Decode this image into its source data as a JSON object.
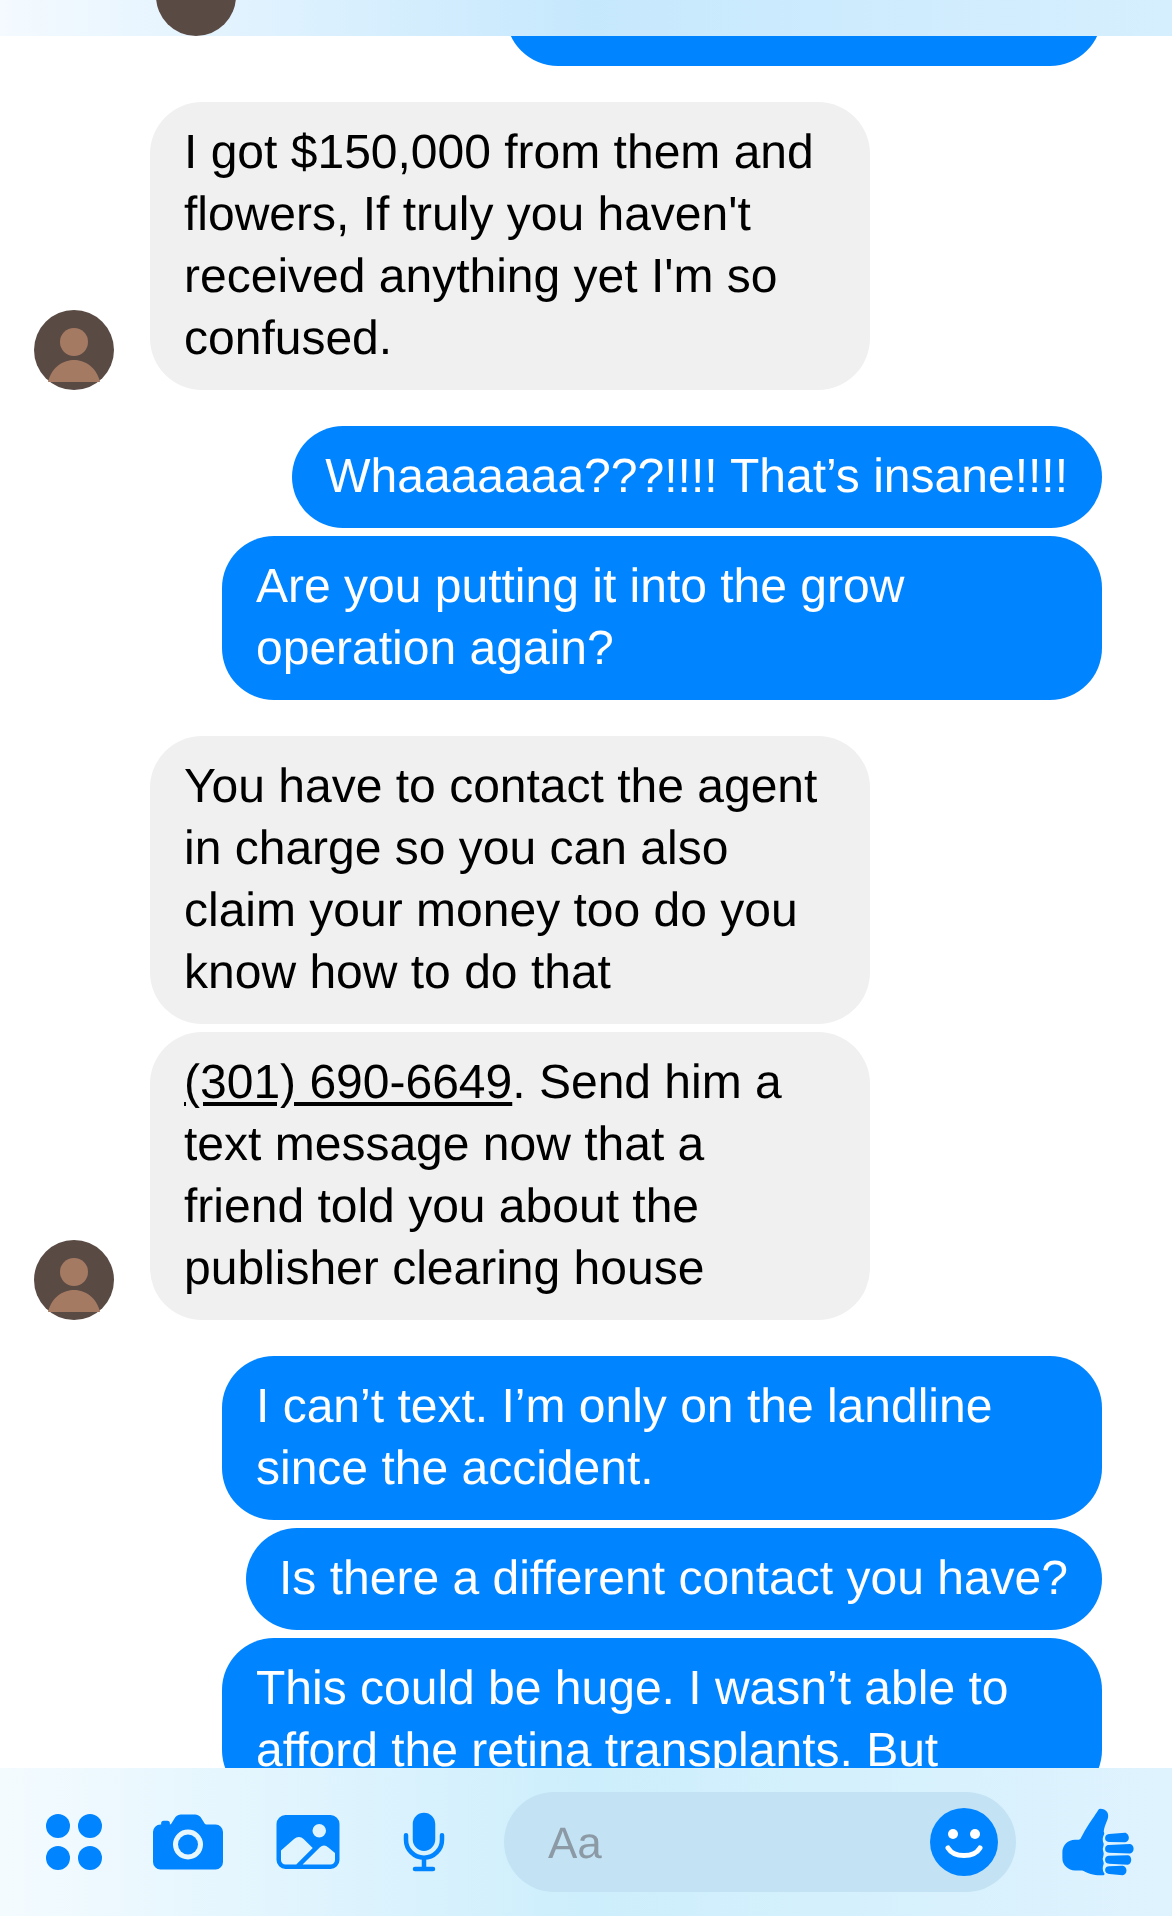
{
  "messages": [
    {
      "kind": "outgoing"
    },
    {
      "kind": "incoming",
      "avatar": true,
      "text": "I got $150,000 from them and flowers, If truly you haven't received anything yet I'm so confused."
    },
    {
      "kind": "outgoing",
      "text": "Whaaaaaaa???!!!! That’s insane!!!!"
    },
    {
      "kind": "outgoing",
      "text": "Are you putting it into the grow operation again?"
    },
    {
      "kind": "incoming",
      "avatar": false,
      "text": "You have to contact the agent in charge so you can also claim your money too do you know how to do that"
    },
    {
      "kind": "incoming",
      "avatar": true,
      "link": "(301) 690-6649",
      "text": ".  Send him a text message now that a friend told you about the publisher clearing house"
    },
    {
      "kind": "outgoing",
      "text": "I can’t text. I’m only on the landline since the accident."
    },
    {
      "kind": "outgoing",
      "text": "Is there a different contact you have?"
    },
    {
      "kind": "outgoing",
      "text": "This could be huge. I wasn’t able to afford the retina transplants. But"
    }
  ],
  "composer": {
    "placeholder": "Aa"
  }
}
